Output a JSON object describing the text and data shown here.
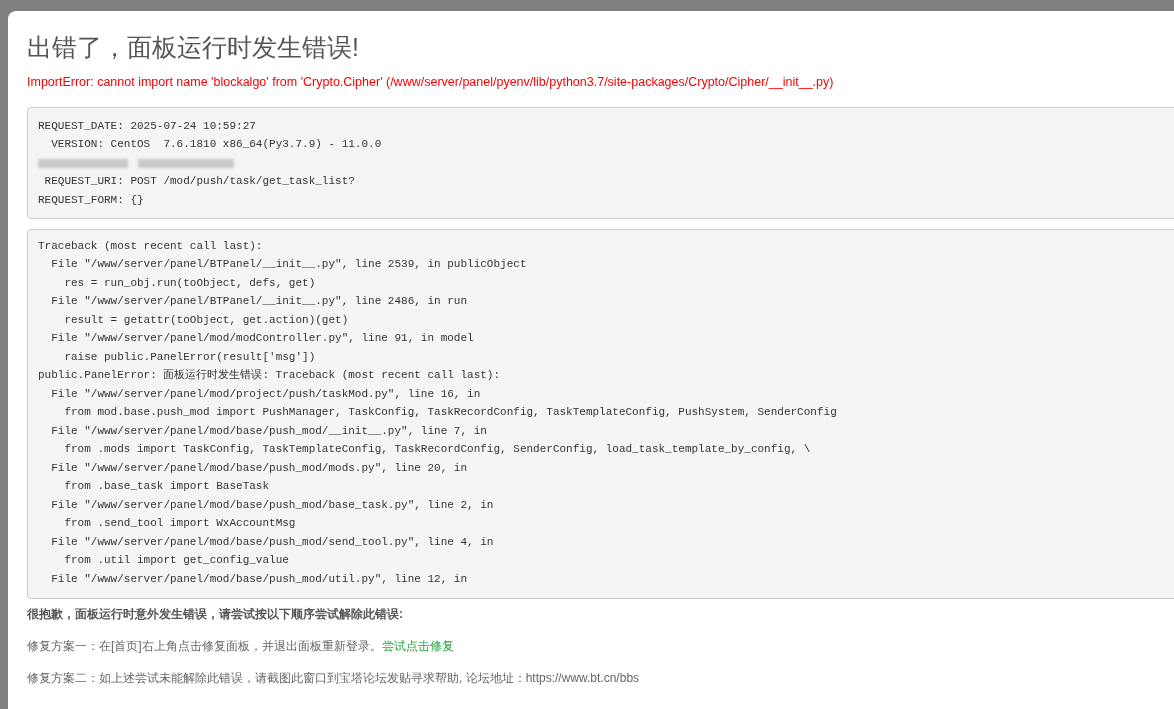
{
  "dialog": {
    "title": "出错了，面板运行时发生错误!",
    "error_message": "ImportError: cannot import name 'blockalgo' from 'Crypto.Cipher' (/www/server/panel/pyenv/lib/python3.7/site-packages/Crypto/Cipher/__init__.py)",
    "request_info": [
      {
        "kind": "text",
        "text": "REQUEST_DATE: 2025-07-24 10:59:27"
      },
      {
        "kind": "text",
        "text": "  VERSION: CentOS  7.6.1810 x86_64(Py3.7.9) - 11.0.0"
      },
      {
        "kind": "redacted"
      },
      {
        "kind": "text",
        "text": " REQUEST_URI: POST /mod/push/task/get_task_list?"
      },
      {
        "kind": "text",
        "text": "REQUEST_FORM: {}"
      }
    ],
    "traceback": [
      "Traceback (most recent call last):",
      "  File \"/www/server/panel/BTPanel/__init__.py\", line 2539, in publicObject",
      "    res = run_obj.run(toObject, defs, get)",
      "  File \"/www/server/panel/BTPanel/__init__.py\", line 2486, in run",
      "    result = getattr(toObject, get.action)(get)",
      "  File \"/www/server/panel/mod/modController.py\", line 91, in model",
      "    raise public.PanelError(result['msg'])",
      "public.PanelError: 面板运行时发生错误: Traceback (most recent call last):",
      "  File \"/www/server/panel/mod/project/push/taskMod.py\", line 16, in",
      "    from mod.base.push_mod import PushManager, TaskConfig, TaskRecordConfig, TaskTemplateConfig, PushSystem, SenderConfig",
      "  File \"/www/server/panel/mod/base/push_mod/__init__.py\", line 7, in",
      "    from .mods import TaskConfig, TaskTemplateConfig, TaskRecordConfig, SenderConfig, load_task_template_by_config, \\",
      "  File \"/www/server/panel/mod/base/push_mod/mods.py\", line 20, in",
      "    from .base_task import BaseTask",
      "  File \"/www/server/panel/mod/base/push_mod/base_task.py\", line 2, in",
      "    from .send_tool import WxAccountMsg",
      "  File \"/www/server/panel/mod/base/push_mod/send_tool.py\", line 4, in",
      "    from .util import get_config_value",
      "  File \"/www/server/panel/mod/base/push_mod/util.py\", line 12, in"
    ],
    "help_heading": "很抱歉，面板运行时意外发生错误，请尝试按以下顺序尝试解除此错误:",
    "fixes": [
      {
        "text": "修复方案一：在[首页]右上角点击修复面板，并退出面板重新登录。",
        "link": "尝试点击修复"
      },
      {
        "text": "修复方案二：如上述尝试未能解除此错误，请截图此窗口到宝塔论坛发贴寻求帮助, 论坛地址：https://www.bt.cn/bbs"
      }
    ]
  }
}
